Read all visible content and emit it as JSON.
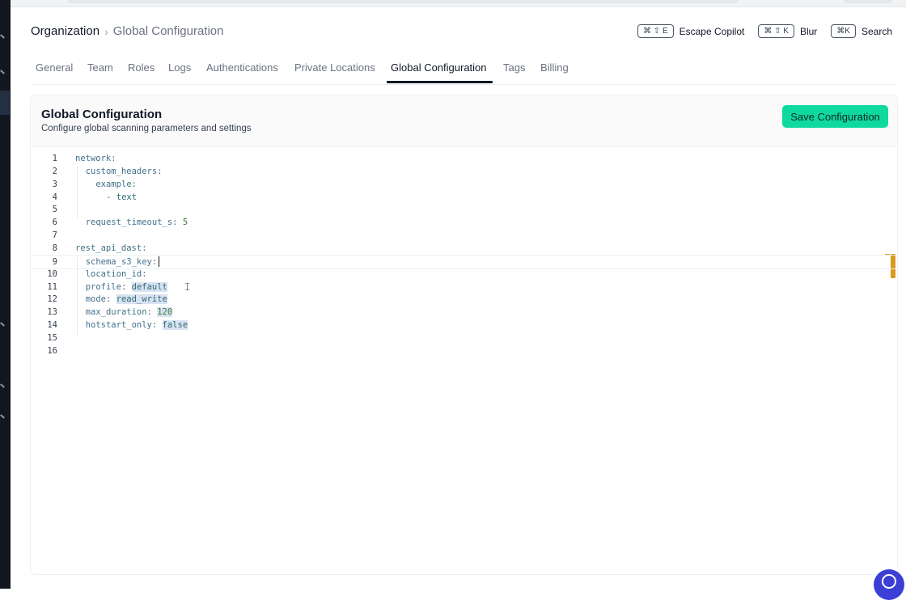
{
  "breadcrumb": {
    "root": "Organization",
    "separator": "›",
    "current": "Global Configuration"
  },
  "shortcuts": [
    {
      "keys": "⌘ ⇧ E",
      "label": "Escape Copilot"
    },
    {
      "keys": "⌘ ⇧ K",
      "label": "Blur"
    },
    {
      "keys": "⌘K",
      "label": "Search"
    }
  ],
  "tabs": [
    "General",
    "Team",
    "Roles",
    "Logs",
    "Authentications",
    "Private Locations",
    "Global Configuration",
    "Tags",
    "Billing"
  ],
  "active_tab": "Global Configuration",
  "panel": {
    "title": "Global Configuration",
    "subtitle": "Configure global scanning parameters and settings",
    "save_label": "Save Configuration"
  },
  "editor": {
    "current_line": 9,
    "lines": [
      {
        "n": "1",
        "key": "network",
        "sep": ":",
        "value": ""
      },
      {
        "n": "2",
        "key": "custom_headers",
        "sep": ":",
        "value": ""
      },
      {
        "n": "3",
        "key": "example",
        "sep": ":",
        "value": ""
      },
      {
        "n": "4",
        "key": "",
        "sep": "- ",
        "value": "text"
      },
      {
        "n": "5",
        "key": "",
        "sep": "",
        "value": ""
      },
      {
        "n": "6",
        "key": "request_timeout_s",
        "sep": ": ",
        "value": "5"
      },
      {
        "n": "7",
        "key": "",
        "sep": "",
        "value": ""
      },
      {
        "n": "8",
        "key": "rest_api_dast",
        "sep": ":",
        "value": ""
      },
      {
        "n": "9",
        "key": "schema_s3_key",
        "sep": ":",
        "value": ""
      },
      {
        "n": "10",
        "key": "location_id",
        "sep": ":",
        "value": ""
      },
      {
        "n": "11",
        "key": "profile",
        "sep": ": ",
        "value": "default"
      },
      {
        "n": "12",
        "key": "mode",
        "sep": ": ",
        "value": "read_write"
      },
      {
        "n": "13",
        "key": "max_duration",
        "sep": ": ",
        "value": "120"
      },
      {
        "n": "14",
        "key": "hotstart_only",
        "sep": ": ",
        "value": "false"
      },
      {
        "n": "15",
        "key": "",
        "sep": "",
        "value": ""
      },
      {
        "n": "16",
        "key": "",
        "sep": "",
        "value": ""
      }
    ]
  },
  "colors": {
    "accent": "#10d9a0",
    "tab_active": "#111827",
    "sidebar": "#12161f",
    "marker": "#d99a1e"
  }
}
